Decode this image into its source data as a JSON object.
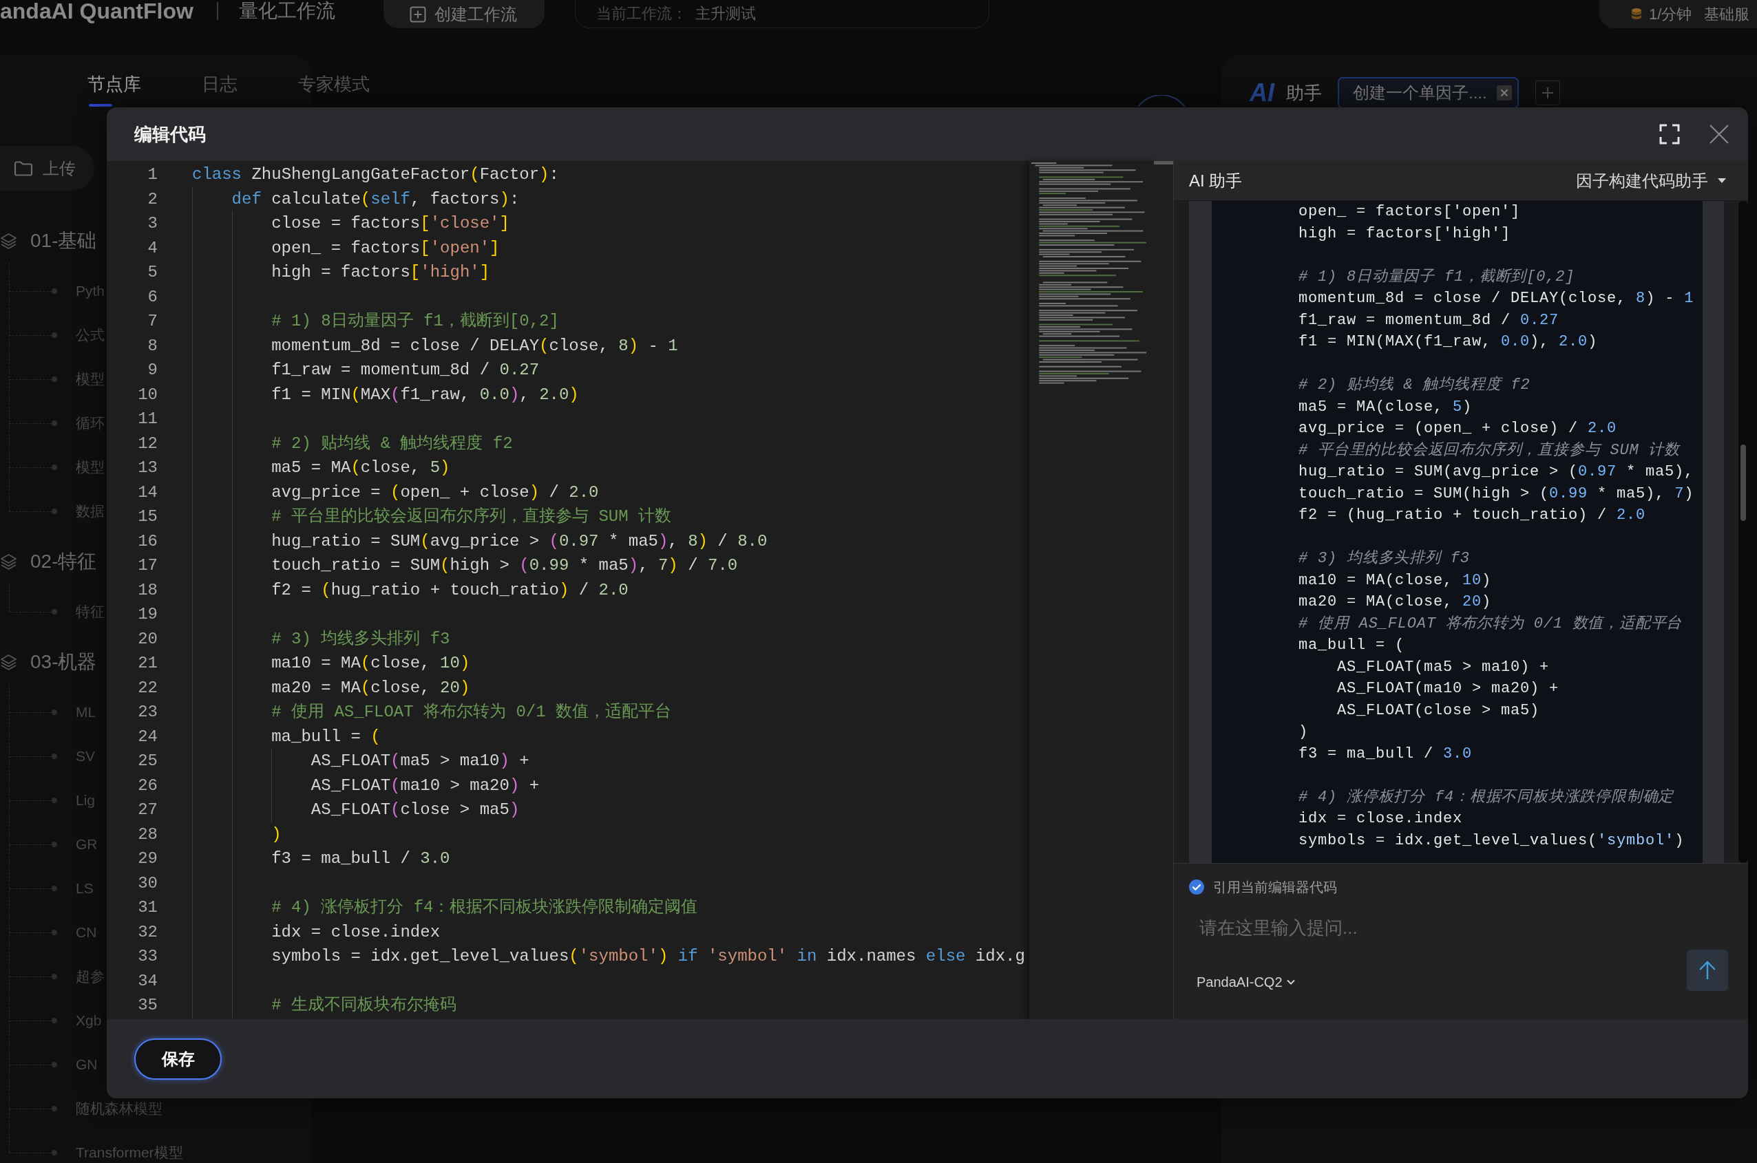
{
  "top_bar": {
    "logo": "andaAI QuantFlow",
    "title": "量化工作流",
    "create_button": "创建工作流",
    "workflow": {
      "label": "当前工作流：",
      "value": "主升测试"
    },
    "rate": "1/分钟",
    "plan": "基础服"
  },
  "left_panel": {
    "tabs": [
      {
        "label": "节点库",
        "selected": true
      },
      {
        "label": "日志",
        "selected": false
      },
      {
        "label": "专家模式",
        "selected": false
      }
    ],
    "upload_button": "上传",
    "groups": [
      {
        "label": "01-基础",
        "children": [
          {
            "label": "Pyth"
          },
          {
            "label": "公式"
          },
          {
            "label": "模型"
          },
          {
            "label": "循环"
          },
          {
            "label": "模型"
          },
          {
            "label": "数据"
          }
        ]
      },
      {
        "label": "02-特征",
        "children": [
          {
            "label": "特征"
          }
        ]
      },
      {
        "label": "03-机器",
        "children": [
          {
            "label": "ML"
          },
          {
            "label": "SV"
          },
          {
            "label": "Lig"
          },
          {
            "label": "GR"
          },
          {
            "label": "LS"
          },
          {
            "label": "CN"
          },
          {
            "label": "超参"
          },
          {
            "label": "Xgb"
          },
          {
            "label": "GN"
          },
          {
            "label": "随机森林模型"
          },
          {
            "label": "Transformer模型"
          }
        ]
      }
    ]
  },
  "assistant_panel": {
    "logo": "AI",
    "title": "助手",
    "tabs": [
      {
        "label": "创建一个单因子....",
        "selected": true
      }
    ]
  },
  "dialog": {
    "title": "编辑代码",
    "editor": {
      "lines": [
        {
          "number": "1",
          "tokens": [
            {
              "kind": "keyword",
              "text": "class"
            },
            {
              "kind": "text",
              "text": " ZhuShengLangGateFactor"
            },
            {
              "kind": "bracket",
              "text": "("
            },
            {
              "kind": "text",
              "text": "Factor"
            },
            {
              "kind": "bracket",
              "text": ")"
            },
            {
              "kind": "text",
              "text": ":"
            }
          ]
        },
        {
          "number": "2",
          "tokens": [
            {
              "kind": "keyword",
              "text": "    def"
            },
            {
              "kind": "text",
              "text": " calculate"
            },
            {
              "kind": "bracket",
              "text": "("
            },
            {
              "kind": "keyword",
              "text": "self"
            },
            {
              "kind": "text",
              "text": ", factors"
            },
            {
              "kind": "bracket",
              "text": ")"
            },
            {
              "kind": "text",
              "text": ":"
            }
          ]
        },
        {
          "number": "3",
          "tokens": [
            {
              "kind": "text",
              "text": "        close = factors"
            },
            {
              "kind": "bracket",
              "text": "["
            },
            {
              "kind": "string",
              "text": "'close'"
            },
            {
              "kind": "bracket",
              "text": "]"
            }
          ]
        },
        {
          "number": "4",
          "tokens": [
            {
              "kind": "text",
              "text": "        open_ = factors"
            },
            {
              "kind": "bracket",
              "text": "["
            },
            {
              "kind": "string",
              "text": "'open'"
            },
            {
              "kind": "bracket",
              "text": "]"
            }
          ]
        },
        {
          "number": "5",
          "tokens": [
            {
              "kind": "text",
              "text": "        high = factors"
            },
            {
              "kind": "bracket",
              "text": "["
            },
            {
              "kind": "string",
              "text": "'high'"
            },
            {
              "kind": "bracket",
              "text": "]"
            }
          ]
        },
        {
          "number": "6"
        },
        {
          "number": "7",
          "tokens": [
            {
              "kind": "comment",
              "text": "        # 1) 8日动量因子 f1，截断到[0,2]"
            }
          ]
        },
        {
          "number": "8",
          "tokens": [
            {
              "kind": "text",
              "text": "        momentum_8d = close / DELAY"
            },
            {
              "kind": "bracket",
              "text": "("
            },
            {
              "kind": "text",
              "text": "close, "
            },
            {
              "kind": "number",
              "text": "8"
            },
            {
              "kind": "bracket",
              "text": ")"
            },
            {
              "kind": "text",
              "text": " - "
            },
            {
              "kind": "number",
              "text": "1"
            }
          ]
        },
        {
          "number": "9",
          "tokens": [
            {
              "kind": "text",
              "text": "        f1_raw = momentum_8d / "
            },
            {
              "kind": "number",
              "text": "0.27"
            }
          ]
        },
        {
          "number": "10",
          "tokens": [
            {
              "kind": "text",
              "text": "        f1 = MIN"
            },
            {
              "kind": "bracket",
              "text": "("
            },
            {
              "kind": "text",
              "text": "MAX"
            },
            {
              "kind": "bracket2",
              "text": "("
            },
            {
              "kind": "text",
              "text": "f1_raw, "
            },
            {
              "kind": "number",
              "text": "0.0"
            },
            {
              "kind": "bracket2",
              "text": ")"
            },
            {
              "kind": "text",
              "text": ", "
            },
            {
              "kind": "number",
              "text": "2.0"
            },
            {
              "kind": "bracket",
              "text": ")"
            }
          ]
        },
        {
          "number": "11"
        },
        {
          "number": "12",
          "tokens": [
            {
              "kind": "comment",
              "text": "        # 2) 贴均线 & 触均线程度 f2"
            }
          ]
        },
        {
          "number": "13",
          "tokens": [
            {
              "kind": "text",
              "text": "        ma5 = MA"
            },
            {
              "kind": "bracket",
              "text": "("
            },
            {
              "kind": "text",
              "text": "close, "
            },
            {
              "kind": "number",
              "text": "5"
            },
            {
              "kind": "bracket",
              "text": ")"
            }
          ]
        },
        {
          "number": "14",
          "tokens": [
            {
              "kind": "text",
              "text": "        avg_price = "
            },
            {
              "kind": "bracket",
              "text": "("
            },
            {
              "kind": "text",
              "text": "open_ + close"
            },
            {
              "kind": "bracket",
              "text": ")"
            },
            {
              "kind": "text",
              "text": " / "
            },
            {
              "kind": "number",
              "text": "2.0"
            }
          ]
        },
        {
          "number": "15",
          "tokens": [
            {
              "kind": "comment",
              "text": "        # 平台里的比较会返回布尔序列，直接参与 SUM 计数"
            }
          ]
        },
        {
          "number": "16",
          "tokens": [
            {
              "kind": "text",
              "text": "        hug_ratio = SUM"
            },
            {
              "kind": "bracket",
              "text": "("
            },
            {
              "kind": "text",
              "text": "avg_price > "
            },
            {
              "kind": "bracket2",
              "text": "("
            },
            {
              "kind": "number",
              "text": "0.97"
            },
            {
              "kind": "text",
              "text": " * ma5"
            },
            {
              "kind": "bracket2",
              "text": ")"
            },
            {
              "kind": "text",
              "text": ", "
            },
            {
              "kind": "number",
              "text": "8"
            },
            {
              "kind": "bracket",
              "text": ")"
            },
            {
              "kind": "text",
              "text": " / "
            },
            {
              "kind": "number",
              "text": "8.0"
            }
          ]
        },
        {
          "number": "17",
          "tokens": [
            {
              "kind": "text",
              "text": "        touch_ratio = SUM"
            },
            {
              "kind": "bracket",
              "text": "("
            },
            {
              "kind": "text",
              "text": "high > "
            },
            {
              "kind": "bracket2",
              "text": "("
            },
            {
              "kind": "number",
              "text": "0.99"
            },
            {
              "kind": "text",
              "text": " * ma5"
            },
            {
              "kind": "bracket2",
              "text": ")"
            },
            {
              "kind": "text",
              "text": ", "
            },
            {
              "kind": "number",
              "text": "7"
            },
            {
              "kind": "bracket",
              "text": ")"
            },
            {
              "kind": "text",
              "text": " / "
            },
            {
              "kind": "number",
              "text": "7.0"
            }
          ]
        },
        {
          "number": "18",
          "tokens": [
            {
              "kind": "text",
              "text": "        f2 = "
            },
            {
              "kind": "bracket",
              "text": "("
            },
            {
              "kind": "text",
              "text": "hug_ratio + touch_ratio"
            },
            {
              "kind": "bracket",
              "text": ")"
            },
            {
              "kind": "text",
              "text": " / "
            },
            {
              "kind": "number",
              "text": "2.0"
            }
          ]
        },
        {
          "number": "19"
        },
        {
          "number": "20",
          "tokens": [
            {
              "kind": "comment",
              "text": "        # 3) 均线多头排列 f3"
            }
          ]
        },
        {
          "number": "21",
          "tokens": [
            {
              "kind": "text",
              "text": "        ma10 = MA"
            },
            {
              "kind": "bracket",
              "text": "("
            },
            {
              "kind": "text",
              "text": "close, "
            },
            {
              "kind": "number",
              "text": "10"
            },
            {
              "kind": "bracket",
              "text": ")"
            }
          ]
        },
        {
          "number": "22",
          "tokens": [
            {
              "kind": "text",
              "text": "        ma20 = MA"
            },
            {
              "kind": "bracket",
              "text": "("
            },
            {
              "kind": "text",
              "text": "close, "
            },
            {
              "kind": "number",
              "text": "20"
            },
            {
              "kind": "bracket",
              "text": ")"
            }
          ]
        },
        {
          "number": "23",
          "tokens": [
            {
              "kind": "comment",
              "text": "        # 使用 AS_FLOAT 将布尔转为 0/1 数值，适配平台"
            }
          ]
        },
        {
          "number": "24",
          "tokens": [
            {
              "kind": "text",
              "text": "        ma_bull = "
            },
            {
              "kind": "bracket",
              "text": "("
            }
          ]
        },
        {
          "number": "25",
          "tokens": [
            {
              "kind": "text",
              "text": "            AS_FLOAT"
            },
            {
              "kind": "bracket2",
              "text": "("
            },
            {
              "kind": "text",
              "text": "ma5 > ma10"
            },
            {
              "kind": "bracket2",
              "text": ")"
            },
            {
              "kind": "text",
              "text": " +"
            }
          ]
        },
        {
          "number": "26",
          "tokens": [
            {
              "kind": "text",
              "text": "            AS_FLOAT"
            },
            {
              "kind": "bracket2",
              "text": "("
            },
            {
              "kind": "text",
              "text": "ma10 > ma20"
            },
            {
              "kind": "bracket2",
              "text": ")"
            },
            {
              "kind": "text",
              "text": " +"
            }
          ]
        },
        {
          "number": "27",
          "tokens": [
            {
              "kind": "text",
              "text": "            AS_FLOAT"
            },
            {
              "kind": "bracket2",
              "text": "("
            },
            {
              "kind": "text",
              "text": "close > ma5"
            },
            {
              "kind": "bracket2",
              "text": ")"
            }
          ]
        },
        {
          "number": "28",
          "tokens": [
            {
              "kind": "bracket",
              "text": "        )"
            }
          ]
        },
        {
          "number": "29",
          "tokens": [
            {
              "kind": "text",
              "text": "        f3 = ma_bull / "
            },
            {
              "kind": "number",
              "text": "3.0"
            }
          ]
        },
        {
          "number": "30"
        },
        {
          "number": "31",
          "tokens": [
            {
              "kind": "comment",
              "text": "        # 4) 涨停板打分 f4：根据不同板块涨跌停限制确定阈值"
            }
          ]
        },
        {
          "number": "32",
          "tokens": [
            {
              "kind": "text",
              "text": "        idx = close.index"
            }
          ]
        },
        {
          "number": "33",
          "tokens": [
            {
              "kind": "text",
              "text": "        symbols = idx.get_level_values"
            },
            {
              "kind": "bracket",
              "text": "("
            },
            {
              "kind": "string",
              "text": "'symbol'"
            },
            {
              "kind": "bracket",
              "text": ")"
            },
            {
              "kind": "keyword",
              "text": " if"
            },
            {
              "kind": "string",
              "text": " 'symbol'"
            },
            {
              "kind": "keyword",
              "text": " in"
            },
            {
              "kind": "text",
              "text": " idx.names "
            },
            {
              "kind": "keyword",
              "text": "else"
            },
            {
              "kind": "text",
              "text": " idx.g"
            }
          ]
        },
        {
          "number": "34"
        },
        {
          "number": "35",
          "tokens": [
            {
              "kind": "comment",
              "text": "        # 生成不同板块布尔掩码"
            }
          ]
        }
      ]
    },
    "assistant": {
      "title": "AI 助手",
      "mode": "因子构建代码助手",
      "code": [
        {
          "kind": "code",
          "tokens": [
            {
              "kind": "text",
              "text": "        open_ = factors['open']"
            }
          ]
        },
        {
          "kind": "code",
          "tokens": [
            {
              "kind": "text",
              "text": "        high = factors['high']"
            }
          ]
        },
        {
          "kind": "blank"
        },
        {
          "kind": "code",
          "tokens": [
            {
              "kind": "comment",
              "text": "        # 1) 8日动量因子 f1，截断到[0,2]"
            }
          ]
        },
        {
          "kind": "code",
          "tokens": [
            {
              "kind": "text",
              "text": "        momentum_8d = close / DELAY(close, "
            },
            {
              "kind": "number",
              "text": "8"
            },
            {
              "kind": "text",
              "text": ") - "
            },
            {
              "kind": "number",
              "text": "1"
            }
          ]
        },
        {
          "kind": "code",
          "tokens": [
            {
              "kind": "text",
              "text": "        f1_raw = momentum_8d / "
            },
            {
              "kind": "number",
              "text": "0.27"
            }
          ]
        },
        {
          "kind": "code",
          "tokens": [
            {
              "kind": "text",
              "text": "        f1 = MIN(MAX(f1_raw, "
            },
            {
              "kind": "number",
              "text": "0.0"
            },
            {
              "kind": "text",
              "text": "), "
            },
            {
              "kind": "number",
              "text": "2.0"
            },
            {
              "kind": "text",
              "text": ")"
            }
          ]
        },
        {
          "kind": "blank"
        },
        {
          "kind": "code",
          "tokens": [
            {
              "kind": "comment",
              "text": "        # 2) 贴均线 & 触均线程度 f2"
            }
          ]
        },
        {
          "kind": "code",
          "tokens": [
            {
              "kind": "text",
              "text": "        ma5 = MA(close, "
            },
            {
              "kind": "number",
              "text": "5"
            },
            {
              "kind": "text",
              "text": ")"
            }
          ]
        },
        {
          "kind": "code",
          "tokens": [
            {
              "kind": "text",
              "text": "        avg_price = (open_ + close) / "
            },
            {
              "kind": "number",
              "text": "2.0"
            }
          ]
        },
        {
          "kind": "code",
          "tokens": [
            {
              "kind": "comment",
              "text": "        # 平台里的比较会返回布尔序列，直接参与 SUM 计数"
            }
          ]
        },
        {
          "kind": "code",
          "tokens": [
            {
              "kind": "text",
              "text": "        hug_ratio = SUM(avg_price > ("
            },
            {
              "kind": "number",
              "text": "0.97"
            },
            {
              "kind": "text",
              "text": " * ma5),"
            }
          ]
        },
        {
          "kind": "code",
          "tokens": [
            {
              "kind": "text",
              "text": "        touch_ratio = SUM(high > ("
            },
            {
              "kind": "number",
              "text": "0.99"
            },
            {
              "kind": "text",
              "text": " * ma5), "
            },
            {
              "kind": "number",
              "text": "7"
            },
            {
              "kind": "text",
              "text": ")"
            }
          ]
        },
        {
          "kind": "code",
          "tokens": [
            {
              "kind": "text",
              "text": "        f2 = (hug_ratio + touch_ratio) / "
            },
            {
              "kind": "number",
              "text": "2.0"
            }
          ]
        },
        {
          "kind": "blank"
        },
        {
          "kind": "code",
          "tokens": [
            {
              "kind": "comment",
              "text": "        # 3) 均线多头排列 f3"
            }
          ]
        },
        {
          "kind": "code",
          "tokens": [
            {
              "kind": "text",
              "text": "        ma10 = MA(close, "
            },
            {
              "kind": "number",
              "text": "10"
            },
            {
              "kind": "text",
              "text": ")"
            }
          ]
        },
        {
          "kind": "code",
          "tokens": [
            {
              "kind": "text",
              "text": "        ma20 = MA(close, "
            },
            {
              "kind": "number",
              "text": "20"
            },
            {
              "kind": "text",
              "text": ")"
            }
          ]
        },
        {
          "kind": "code",
          "tokens": [
            {
              "kind": "comment",
              "text": "        # 使用 AS_FLOAT 将布尔转为 0/1 数值，适配平台"
            }
          ]
        },
        {
          "kind": "code",
          "tokens": [
            {
              "kind": "text",
              "text": "        ma_bull = ("
            }
          ]
        },
        {
          "kind": "code",
          "tokens": [
            {
              "kind": "text",
              "text": "            AS_FLOAT(ma5 > ma10) +"
            }
          ]
        },
        {
          "kind": "code",
          "tokens": [
            {
              "kind": "text",
              "text": "            AS_FLOAT(ma10 > ma20) +"
            }
          ]
        },
        {
          "kind": "code",
          "tokens": [
            {
              "kind": "text",
              "text": "            AS_FLOAT(close > ma5)"
            }
          ]
        },
        {
          "kind": "code",
          "tokens": [
            {
              "kind": "text",
              "text": "        )"
            }
          ]
        },
        {
          "kind": "code",
          "tokens": [
            {
              "kind": "text",
              "text": "        f3 = ma_bull / "
            },
            {
              "kind": "number",
              "text": "3.0"
            }
          ]
        },
        {
          "kind": "blank"
        },
        {
          "kind": "code",
          "tokens": [
            {
              "kind": "comment",
              "text": "        # 4) 涨停板打分 f4：根据不同板块涨跌停限制确定"
            }
          ]
        },
        {
          "kind": "code",
          "tokens": [
            {
              "kind": "text",
              "text": "        idx = close.index"
            }
          ]
        },
        {
          "kind": "code",
          "tokens": [
            {
              "kind": "text",
              "text": "        symbols = idx.get_level_values("
            },
            {
              "kind": "string",
              "text": "'symbol'"
            },
            {
              "kind": "text",
              "text": ")"
            }
          ]
        }
      ],
      "quote_code": {
        "label": "引用当前编辑器代码",
        "checked": true
      },
      "input": {
        "placeholder": "请在这里输入提问..."
      },
      "model": "PandaAI-CQ2"
    },
    "save_button": "保存"
  }
}
